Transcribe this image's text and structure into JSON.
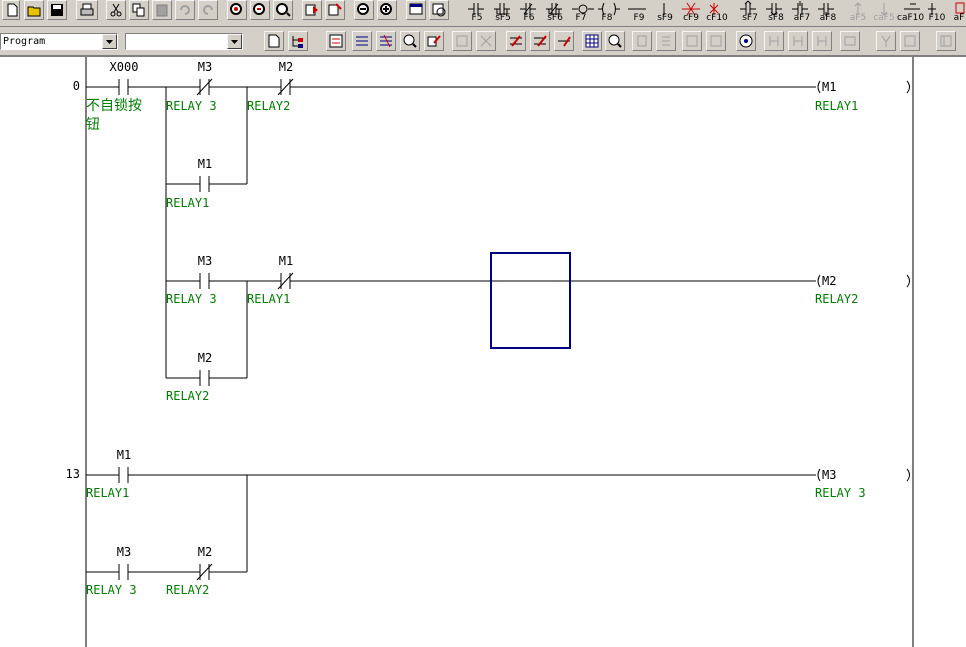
{
  "toolbar": {
    "fkeys": [
      {
        "label": "F5"
      },
      {
        "label": "sF5"
      },
      {
        "label": "F6"
      },
      {
        "label": "sF6"
      },
      {
        "label": "F7"
      },
      {
        "label": "F8"
      },
      {
        "label": "F9"
      },
      {
        "label": "sF9"
      },
      {
        "label": "cF9"
      },
      {
        "label": "cF10"
      },
      {
        "label": "sF7"
      },
      {
        "label": "sF8"
      },
      {
        "label": "aF7"
      },
      {
        "label": "aF8"
      },
      {
        "label": "aF5"
      },
      {
        "label": "caF5"
      },
      {
        "label": "caF10"
      },
      {
        "label": "F10"
      },
      {
        "label": "aF"
      }
    ]
  },
  "combo": {
    "mode": "Program",
    "second": ""
  },
  "ladder": {
    "steps": [
      "0",
      "13"
    ],
    "rung1": {
      "x000": {
        "label": "X000",
        "comment_line1": "不自锁按",
        "comment_line2": "钮"
      },
      "m3": {
        "label": "M3",
        "comment": "RELAY 3"
      },
      "m2": {
        "label": "M2",
        "comment": "RELAY2"
      },
      "m1_parallel": {
        "label": "M1",
        "comment": "RELAY1"
      },
      "coil": {
        "label": "M1",
        "comment": "RELAY1"
      }
    },
    "rung2": {
      "m3": {
        "label": "M3",
        "comment": "RELAY 3"
      },
      "m1": {
        "label": "M1",
        "comment": "RELAY1"
      },
      "m2_parallel": {
        "label": "M2",
        "comment": "RELAY2"
      },
      "coil": {
        "label": "M2",
        "comment": "RELAY2"
      }
    },
    "rung3": {
      "m1": {
        "label": "M1",
        "comment": "RELAY1"
      },
      "m3": {
        "label": "M3",
        "comment": "RELAY 3"
      },
      "m2": {
        "label": "M2",
        "comment": "RELAY2"
      },
      "coil": {
        "label": "M3",
        "comment": "RELAY 3"
      }
    }
  }
}
